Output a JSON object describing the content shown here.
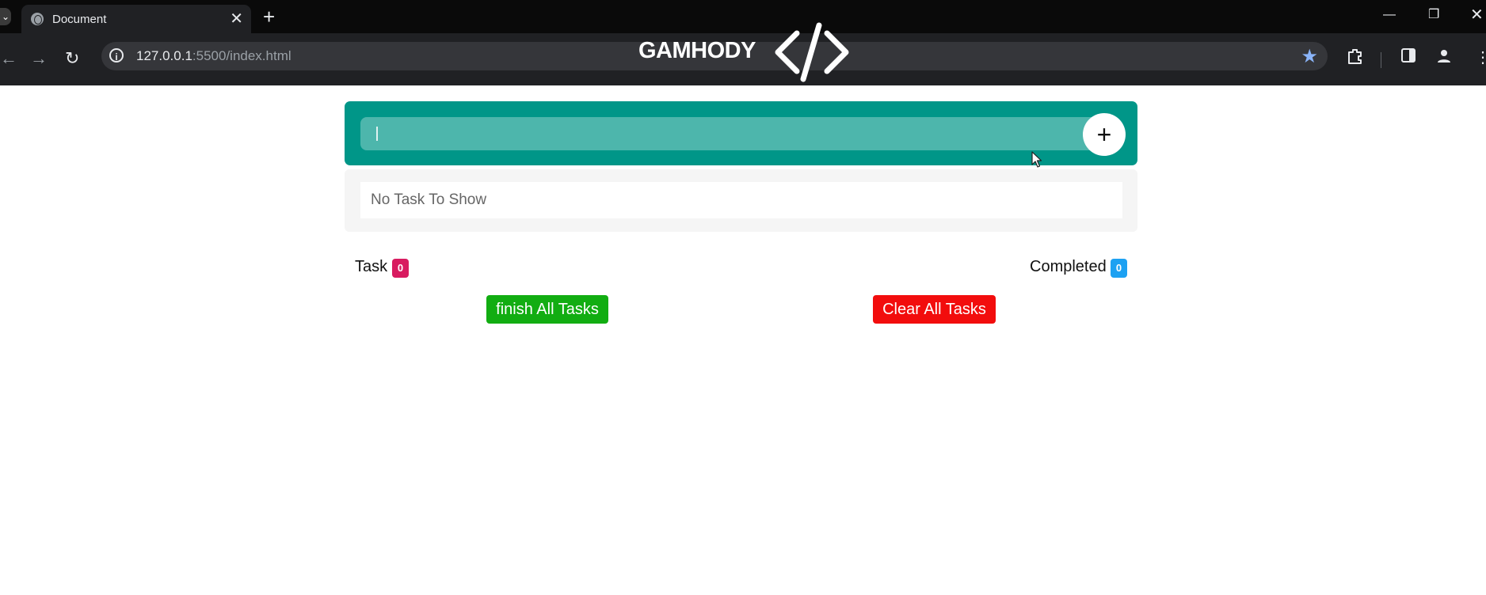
{
  "browser": {
    "tab_title": "Document",
    "tab_close": "✕",
    "new_tab": "+",
    "url_host": "127.0.0.1",
    "url_path": ":5500/index.html",
    "site_info_glyph": "i",
    "icons": [
      "back-arrow-icon",
      "forward-arrow-icon",
      "reload-icon",
      "info-icon",
      "star-icon",
      "extensions-icon",
      "side-panel-icon",
      "profile-icon",
      "menu-icon"
    ]
  },
  "logo": {
    "text": "GAMHODY"
  },
  "app": {
    "input_value": "",
    "add_button_label": "+",
    "empty_message": "No Task To Show",
    "task_label": "Task",
    "task_count": "0",
    "completed_label": "Completed",
    "completed_count": "0",
    "finish_button_label": "finish All Tasks",
    "clear_button_label": "Clear All Tasks"
  },
  "colors": {
    "header": "#009688",
    "input": "#4db6ac",
    "task_badge": "#d81b60",
    "completed_badge": "#1da1f2",
    "finish_button": "#12ad12",
    "clear_button": "#f20d0d"
  }
}
